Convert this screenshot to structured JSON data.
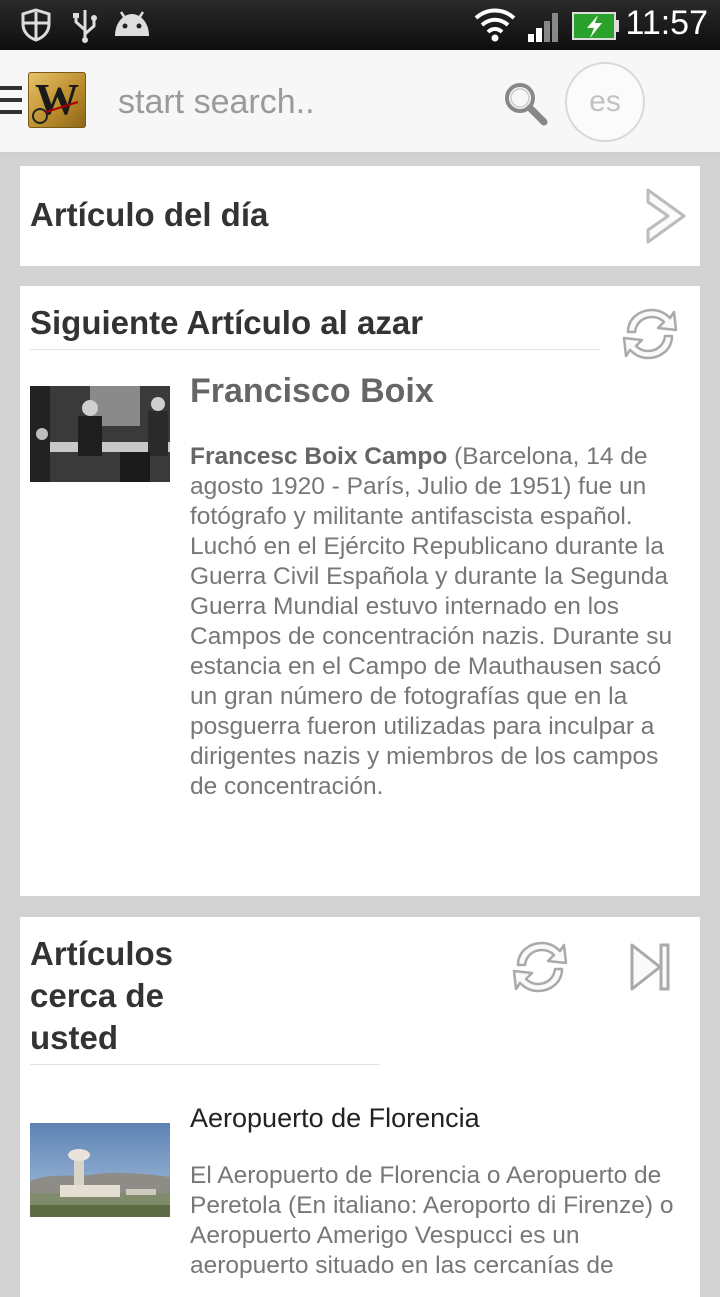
{
  "status_bar": {
    "time": "11:57",
    "left_icons": [
      "shield-icon",
      "usb-icon",
      "android-icon"
    ],
    "right_icons": [
      "wifi-icon",
      "signal-icon",
      "battery-charging-icon"
    ]
  },
  "app_bar": {
    "menu_icon": "hamburger-menu-icon",
    "logo_letter": "W",
    "search_placeholder": "start search..",
    "search_icon": "search-icon",
    "language": "es"
  },
  "cards": {
    "article_of_day": {
      "title": "Artículo del día",
      "icon": "chevron-right-icon"
    },
    "random_article": {
      "title": "Siguiente Artículo al azar",
      "refresh_icon": "refresh-icon",
      "article_title": "Francisco Boix",
      "summary_bold": "Francesc Boix Campo",
      "summary_rest": " (Barcelona, 14 de agosto 1920 - París, Julio de 1951) fue un fotógrafo y militante antifascista español. Luchó en el Ejército Republicano durante la Guerra Civil Española y durante la Segunda Guerra Mundial estuvo internado en los Campos de concentración nazis. Durante su estancia en el Campo de Mauthausen sacó un gran número de fotografías que en la posguerra fueron utilizadas para inculpar a dirigentes nazis y miembros de los campos de concentración."
    },
    "nearby": {
      "title_lines": [
        "Artículos",
        "cerca de",
        "usted"
      ],
      "refresh_icon": "refresh-icon",
      "next_icon": "skip-next-icon",
      "article_title": "Aeropuerto de Florencia",
      "summary": "El Aeropuerto de Florencia o Aeropuerto de Peretola (En  italiano: Aeroporto di Firenze) o Aeropuerto Amerigo Vespucci es un aeropuerto situado en las cercanías de"
    }
  },
  "colors": {
    "background": "#d2d2d2",
    "card": "#ffffff",
    "title_text": "#333333",
    "body_text": "#777777"
  }
}
